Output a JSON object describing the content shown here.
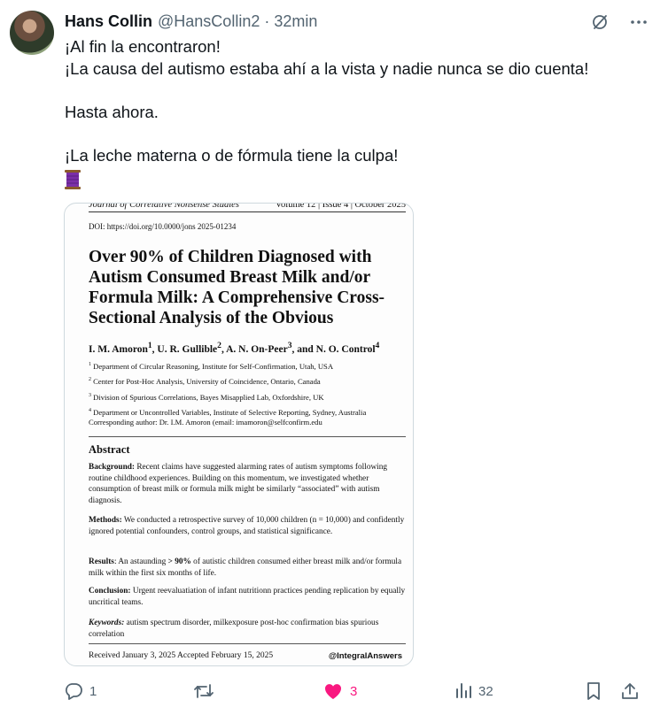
{
  "tweet": {
    "author_name": "Hans Collin",
    "handle": "@HansCollin2",
    "separator": "·",
    "time": "32min",
    "lines": [
      "¡Al fin la encontraron!",
      "¡La causa del autismo estaba ahí a la vista y nadie nunca se dio cuenta!",
      "",
      "Hasta ahora.",
      "",
      "¡La leche materna o de fórmula tiene la culpa!"
    ],
    "emoji_icon": "thread-spool-icon"
  },
  "paper": {
    "journal": "Journal of Correlative Nonsense Studies",
    "issue": "Volume 12 | Issue 4 | October 2025",
    "doi": "DOI: https://doi.org/10.0000/jons 2025-01234",
    "title": "Over 90% of Children Diagnosed with Autism Consumed Breast Milk and/or Formula Milk: A Comprehensive Cross-Sectional Analysis of the Obvious",
    "authors": [
      {
        "name": "I. M. Amoron",
        "sup": "1"
      },
      {
        "name": "U. R. Gullible",
        "sup": "2"
      },
      {
        "name": "A. N. On-Peer",
        "sup": "3"
      },
      {
        "name": "N. O. Control",
        "sup": "4"
      }
    ],
    "authors_sep1": ", ",
    "authors_sep2": ", and ",
    "affiliations": [
      {
        "sup": "1",
        "text": "Department of Circular Reasoning, Institute for Self-Confirmation, Utah, USA"
      },
      {
        "sup": "2",
        "text": "Center for Post-Hoc Analysis, University of Coincidence, Ontario, Canada"
      },
      {
        "sup": "3",
        "text": "Division of Spurious Correlations, Bayes Misapplied Lab, Oxfordshire, UK"
      },
      {
        "sup": "4",
        "text": "Department or Uncontrolled Variables, Institute of Selective Reporting, Sydney, Australia"
      }
    ],
    "corresponding": "Corresponding author: Dr. I.M. Amoron (email: imamoron@selfconfirm.edu",
    "abstract_heading": "Abstract",
    "background_label": "Background:",
    "background": "Recent claims have suggested alarming rates of autism symptoms following routine childhood experiences. Building on this momentum, we investigated whether consumption of breast milk or formula milk might be similarly “associated” with autism diagnosis.",
    "methods_label": "Methods:",
    "methods": "We conducted a retrospective survey of 10,000 children (n = 10,000) and confidently ignored potential confounders, control groups, and statistical significance.",
    "results_label": "Results",
    "results_pre": ": An astaunding ",
    "results_bold": "> 90%",
    "results_post": " of autistic children consumed either breast milk and/or formula milk within the first six months of life.",
    "conclusion_label": "Conclusion:",
    "conclusion": "Urgent reevaluatiation of infant nutritionn practices pending replication by equally uncritical teams.",
    "keywords_label": "Keywords:",
    "keywords": "autism spectrum disorder,  milkexposure  post-hoc confirmation bias spurious correlation",
    "received": "Received January 3, 2025   Accepted February 15, 2025",
    "credit": "@IntegralAnswers"
  },
  "actions": {
    "reply_count": "1",
    "like_count": "3",
    "views_count": "32",
    "like_color": "#f91880",
    "icon_color": "#536471"
  },
  "icons": {
    "grok": "grok-slash-icon",
    "more": "more-dots-icon",
    "reply": "reply-bubble-icon",
    "retweet": "retweet-icon",
    "like": "heart-icon",
    "views": "views-bar-icon",
    "bookmark": "bookmark-icon",
    "share": "share-icon"
  }
}
